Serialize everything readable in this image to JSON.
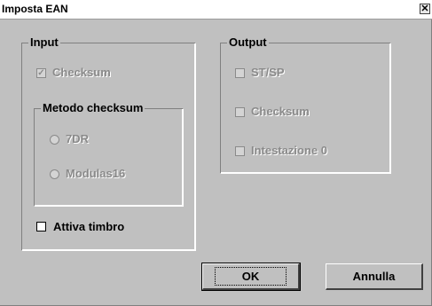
{
  "window": {
    "title": "Imposta EAN",
    "close_glyph": "✕"
  },
  "input_group": {
    "legend": "Input",
    "checksum": {
      "label": "Checksum",
      "checked": true,
      "enabled": false
    },
    "metodo": {
      "legend": "Metodo checksum",
      "options": [
        {
          "label": "7DR",
          "selected": false,
          "enabled": false
        },
        {
          "label": "Modulas16",
          "selected": false,
          "enabled": false
        }
      ]
    },
    "attiva_timbro": {
      "label": "Attiva timbro",
      "checked": false,
      "enabled": true
    }
  },
  "output_group": {
    "legend": "Output",
    "items": [
      {
        "label": "ST/SP",
        "checked": false,
        "enabled": false
      },
      {
        "label": "Checksum",
        "checked": false,
        "enabled": false
      },
      {
        "label": "Intestazione 0",
        "checked": false,
        "enabled": false
      }
    ]
  },
  "buttons": {
    "ok_label": "OK",
    "cancel_label": "Annulla"
  },
  "icons": {
    "check_glyph": "✓"
  }
}
